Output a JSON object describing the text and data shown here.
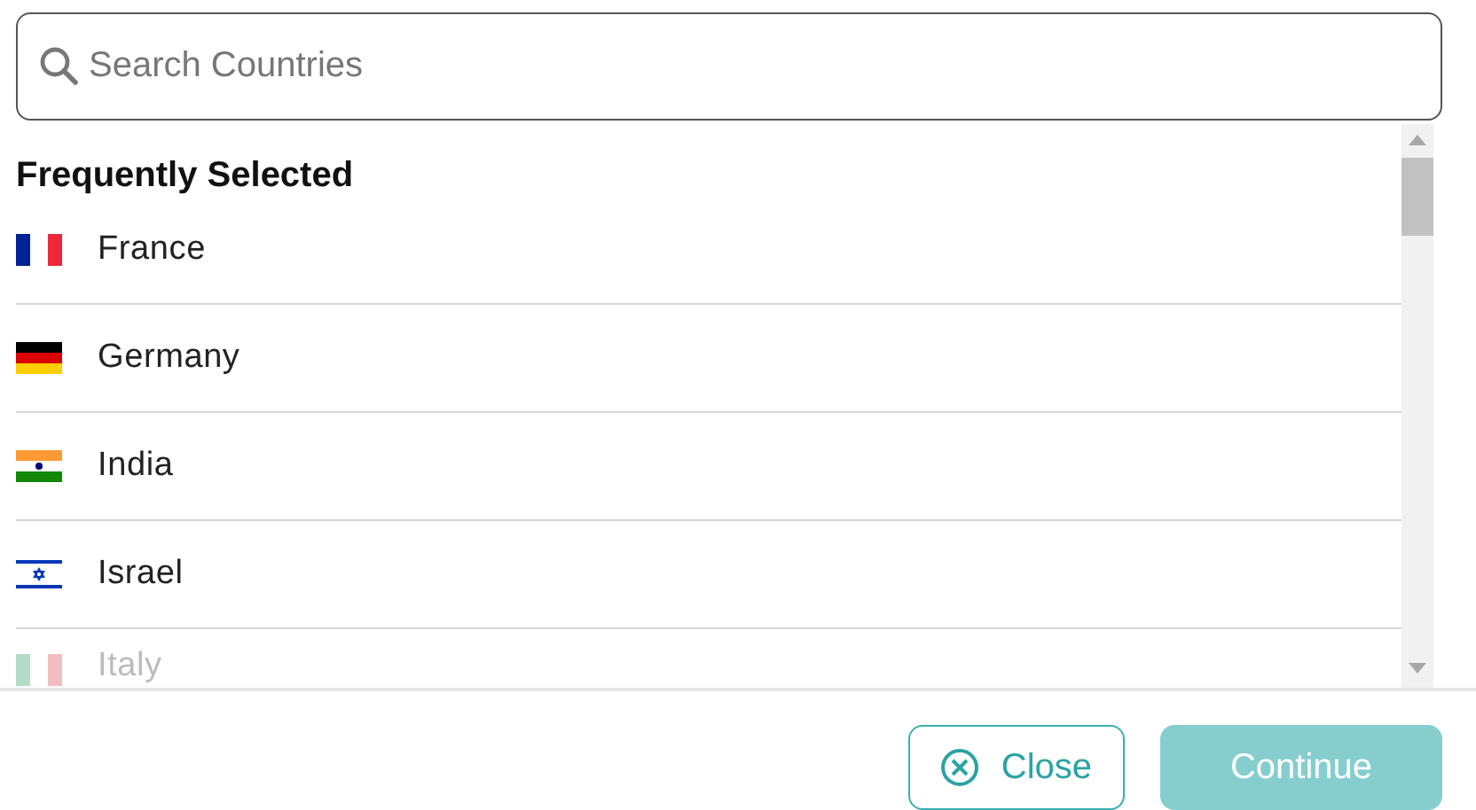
{
  "search": {
    "placeholder": "Search Countries"
  },
  "section": {
    "title": "Frequently Selected"
  },
  "countries": [
    {
      "name": "France",
      "kind": "fr"
    },
    {
      "name": "Germany",
      "kind": "de"
    },
    {
      "name": "India",
      "kind": "in"
    },
    {
      "name": "Israel",
      "kind": "il"
    },
    {
      "name": "Italy",
      "kind": "it"
    }
  ],
  "buttons": [
    {
      "kind": "outline",
      "label": "Close",
      "disabled": false
    },
    {
      "kind": "primary",
      "label": "Continue",
      "disabled": true
    }
  ]
}
